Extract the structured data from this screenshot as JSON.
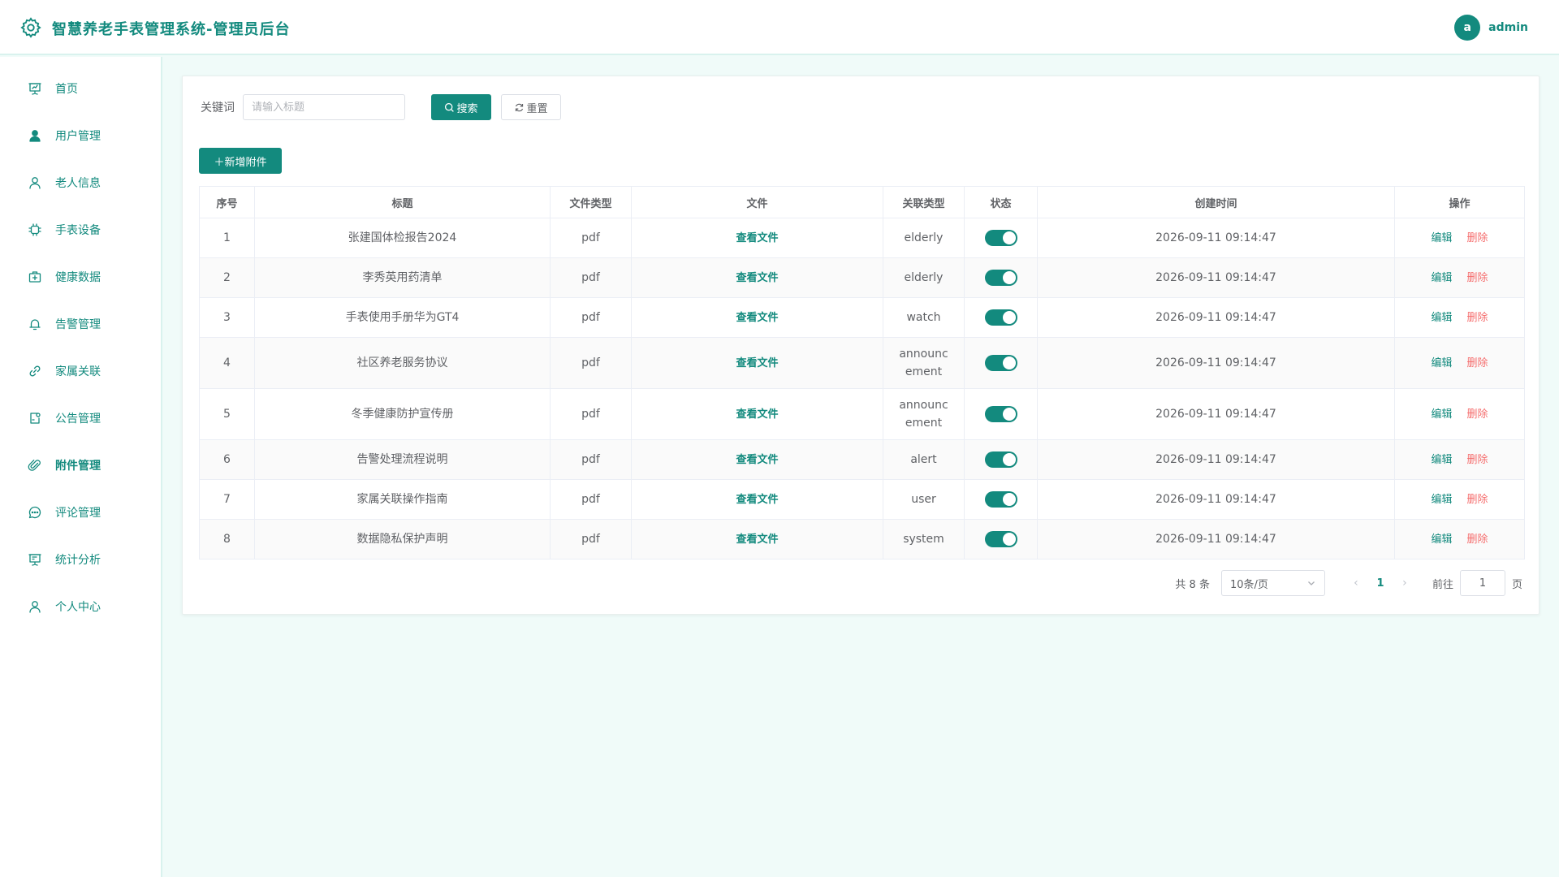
{
  "app": {
    "title": "智慧养老手表管理系统-管理员后台",
    "user_initial": "a",
    "username": "admin",
    "accent": "#138a7e"
  },
  "sidebar": {
    "items": [
      {
        "label": "首页",
        "icon": "presentation-icon"
      },
      {
        "label": "用户管理",
        "icon": "user-filled-icon"
      },
      {
        "label": "老人信息",
        "icon": "user-icon"
      },
      {
        "label": "手表设备",
        "icon": "cpu-icon"
      },
      {
        "label": "健康数据",
        "icon": "first-aid-icon"
      },
      {
        "label": "告警管理",
        "icon": "bell-icon"
      },
      {
        "label": "家属关联",
        "icon": "link-icon"
      },
      {
        "label": "公告管理",
        "icon": "notebook-icon"
      },
      {
        "label": "附件管理",
        "icon": "paperclip-icon",
        "active": true
      },
      {
        "label": "评论管理",
        "icon": "chat-icon"
      },
      {
        "label": "统计分析",
        "icon": "chart-board-icon"
      },
      {
        "label": "个人中心",
        "icon": "user-icon"
      }
    ]
  },
  "search": {
    "label": "关键词",
    "placeholder": "请输入标题",
    "search_label": "搜索",
    "reset_label": "重置"
  },
  "toolbar": {
    "add_label": "＋新增附件"
  },
  "table": {
    "headers": [
      "序号",
      "标题",
      "文件类型",
      "文件",
      "关联类型",
      "状态",
      "创建时间",
      "操作"
    ],
    "view_label": "查看文件",
    "edit_label": "编辑",
    "delete_label": "删除",
    "rows": [
      {
        "no": "1",
        "title": "张建国体检报告2024",
        "type": "pdf",
        "rel": "elderly",
        "enabled": true,
        "created": "2026-09-11 09:14:47"
      },
      {
        "no": "2",
        "title": "李秀英用药清单",
        "type": "pdf",
        "rel": "elderly",
        "enabled": true,
        "created": "2026-09-11 09:14:47"
      },
      {
        "no": "3",
        "title": "手表使用手册华为GT4",
        "type": "pdf",
        "rel": "watch",
        "enabled": true,
        "created": "2026-09-11 09:14:47"
      },
      {
        "no": "4",
        "title": "社区养老服务协议",
        "type": "pdf",
        "rel": "announcement",
        "enabled": true,
        "created": "2026-09-11 09:14:47"
      },
      {
        "no": "5",
        "title": "冬季健康防护宣传册",
        "type": "pdf",
        "rel": "announcement",
        "enabled": true,
        "created": "2026-09-11 09:14:47"
      },
      {
        "no": "6",
        "title": "告警处理流程说明",
        "type": "pdf",
        "rel": "alert",
        "enabled": true,
        "created": "2026-09-11 09:14:47"
      },
      {
        "no": "7",
        "title": "家属关联操作指南",
        "type": "pdf",
        "rel": "user",
        "enabled": true,
        "created": "2026-09-11 09:14:47"
      },
      {
        "no": "8",
        "title": "数据隐私保护声明",
        "type": "pdf",
        "rel": "system",
        "enabled": true,
        "created": "2026-09-11 09:14:47"
      }
    ]
  },
  "pagination": {
    "total": "共 8 条",
    "page_size": "10条/页",
    "current_page": "1",
    "goto_label": "前往",
    "goto_value": "1",
    "page_suffix": "页"
  }
}
